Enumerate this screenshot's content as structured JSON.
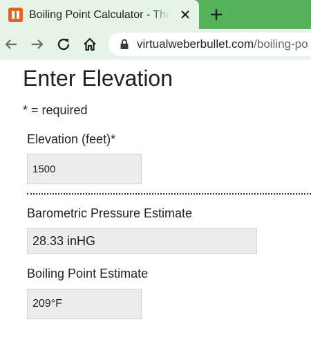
{
  "browser": {
    "tab": {
      "favicon_text": "❙❙",
      "title": "Boiling Point Calculator - The Virtual Weber Bullet"
    },
    "url": {
      "domain": "virtualweberbullet.com",
      "path": "/boiling-po"
    },
    "icons": {
      "back": "back-arrow-icon",
      "forward": "forward-arrow-icon",
      "reload": "reload-icon",
      "home": "home-icon",
      "lock": "lock-icon",
      "close": "close-icon",
      "new_tab": "plus-icon"
    },
    "colors": {
      "tab_strip": "#55b35c",
      "toolbar": "#e8f3e8",
      "favicon": "#e0652d"
    }
  },
  "page": {
    "title": "Enter Elevation",
    "required_note": "* = required",
    "elevation": {
      "label": "Elevation (feet)*",
      "value": "1500"
    },
    "pressure": {
      "label": "Barometric Pressure Estimate",
      "value": "28.33 inHG"
    },
    "boiling": {
      "label": "Boiling Point Estimate",
      "value": "209°F"
    }
  }
}
